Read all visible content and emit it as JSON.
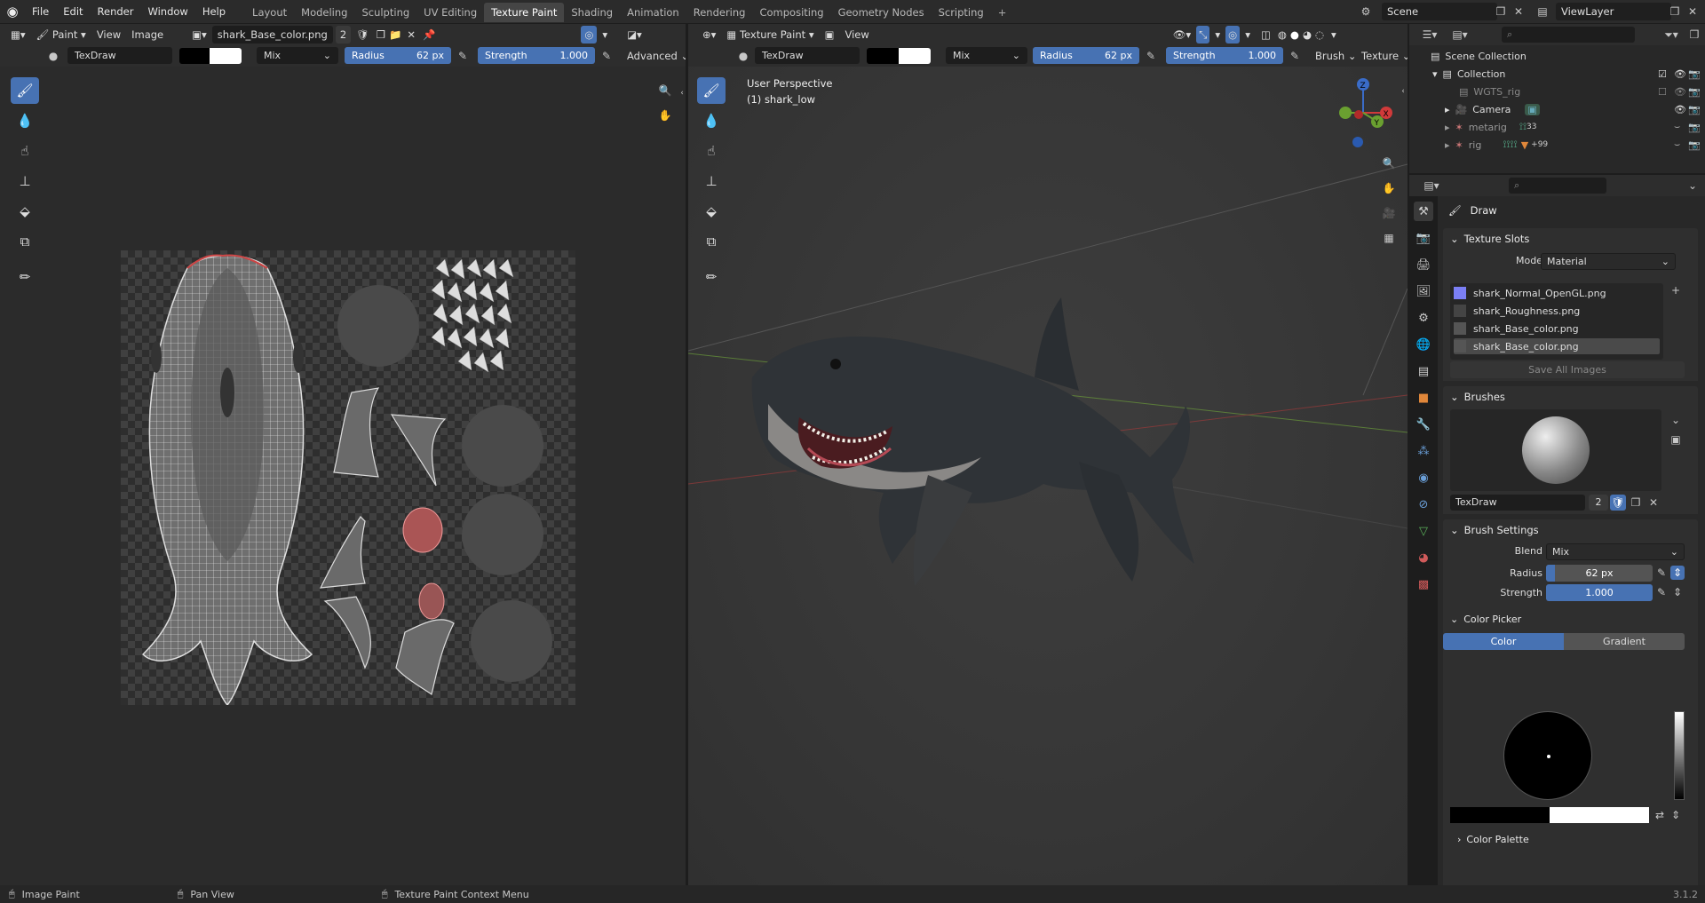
{
  "top_menu": [
    "File",
    "Edit",
    "Render",
    "Window",
    "Help"
  ],
  "workspaces": [
    "Layout",
    "Modeling",
    "Sculpting",
    "UV Editing",
    "Texture Paint",
    "Shading",
    "Animation",
    "Rendering",
    "Compositing",
    "Geometry Nodes",
    "Scripting"
  ],
  "active_workspace": "Texture Paint",
  "scene_name": "Scene",
  "view_layer": "ViewLayer",
  "image_editor": {
    "mode": "Paint",
    "menus": [
      "View",
      "Image"
    ],
    "image_name": "shark_Base_color.png",
    "users": "2",
    "brush": "TexDraw",
    "blend": "Mix",
    "radius_label": "Radius",
    "radius_value": "62 px",
    "strength_label": "Strength",
    "strength_value": "1.000",
    "advanced": "Advanced"
  },
  "viewport": {
    "mode": "Texture Paint",
    "menus": [
      "View"
    ],
    "brush": "TexDraw",
    "blend": "Mix",
    "radius_label": "Radius",
    "radius_value": "62 px",
    "strength_label": "Strength",
    "strength_value": "1.000",
    "brush_menu": "Brush",
    "texture_menu": "Texture",
    "overlay_line1": "User Perspective",
    "overlay_line2": "(1) shark_low",
    "gizmo": {
      "z": "Z",
      "y": "Y",
      "x": "X"
    }
  },
  "outliner": {
    "root": "Scene Collection",
    "items": [
      {
        "name": "Collection",
        "level": 0
      },
      {
        "name": "WGTS_rig",
        "level": 1
      },
      {
        "name": "Camera",
        "level": 1
      },
      {
        "name": "metarig",
        "level": 1,
        "badge": "33"
      },
      {
        "name": "rig",
        "level": 1,
        "badge": "+99"
      }
    ]
  },
  "properties": {
    "tool_name": "Draw",
    "texture_slots": {
      "title": "Texture Slots",
      "mode_label": "Mode",
      "mode_value": "Material",
      "slots": [
        "shark_Normal_OpenGL.png",
        "shark_Roughness.png",
        "shark_Base_color.png",
        "shark_Base_color.png"
      ],
      "save_all": "Save All Images"
    },
    "brushes": {
      "title": "Brushes",
      "brush_name": "TexDraw",
      "users": "2"
    },
    "brush_settings": {
      "title": "Brush Settings",
      "blend_label": "Blend",
      "blend_value": "Mix",
      "radius_label": "Radius",
      "radius_value": "62 px",
      "strength_label": "Strength",
      "strength_value": "1.000"
    },
    "color_picker": {
      "title": "Color Picker",
      "tab_color": "Color",
      "tab_gradient": "Gradient"
    },
    "color_palette": "Color Palette"
  },
  "status_bar": {
    "left": "Image Paint",
    "middle": "Pan View",
    "right": "Texture Paint Context Menu",
    "version": "3.1.2"
  },
  "colors": {
    "accent": "#4772b3",
    "header_bg": "#2d2d2d",
    "panel_bg": "#2f2f2f"
  }
}
